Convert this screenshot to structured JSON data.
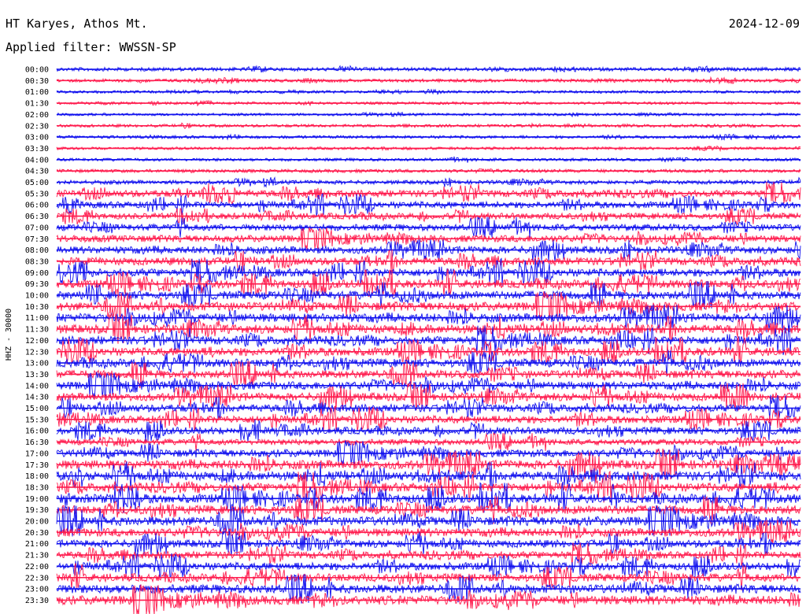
{
  "header": {
    "station": "HT Karyes, Athos Mt.",
    "date": "2024-12-09",
    "filter": "Applied filter: WWSSN-SP"
  },
  "side_label": "HHZ - 30000",
  "colors": {
    "even": "#1010ee",
    "odd": "#ff1a4d"
  },
  "chart_data": {
    "type": "line",
    "title": "HT Karyes, Athos Mt.",
    "subtitle": "Applied filter: WWSSN-SP",
    "date": "2024-12-09",
    "ylabel": "HHZ - 30000",
    "rows": [
      "00:00",
      "00:30",
      "01:00",
      "01:30",
      "02:00",
      "02:30",
      "03:00",
      "03:30",
      "04:00",
      "04:30",
      "05:00",
      "05:30",
      "06:00",
      "06:30",
      "07:00",
      "07:30",
      "08:00",
      "08:30",
      "09:00",
      "09:30",
      "10:00",
      "10:30",
      "11:00",
      "11:30",
      "12:00",
      "12:30",
      "13:00",
      "13:30",
      "14:00",
      "14:30",
      "15:00",
      "15:30",
      "16:00",
      "16:30",
      "17:00",
      "17:30",
      "18:00",
      "18:30",
      "19:00",
      "19:30",
      "20:00",
      "20:30",
      "21:00",
      "21:30",
      "22:00",
      "22:30",
      "23:00",
      "23:30"
    ],
    "activity": [
      0.25,
      0.2,
      0.12,
      0.1,
      0.1,
      0.15,
      0.15,
      0.12,
      0.15,
      0.2,
      0.3,
      0.7,
      0.65,
      0.6,
      0.65,
      0.7,
      0.75,
      0.8,
      0.85,
      0.9,
      0.9,
      0.95,
      0.95,
      0.95,
      0.9,
      0.9,
      0.9,
      0.85,
      0.85,
      0.85,
      0.8,
      0.8,
      0.75,
      0.55,
      0.8,
      1.0,
      1.0,
      0.95,
      1.0,
      0.95,
      1.0,
      0.9,
      0.8,
      0.75,
      0.8,
      0.85,
      0.95,
      1.0
    ],
    "series_colors": [
      "blue",
      "red"
    ]
  }
}
